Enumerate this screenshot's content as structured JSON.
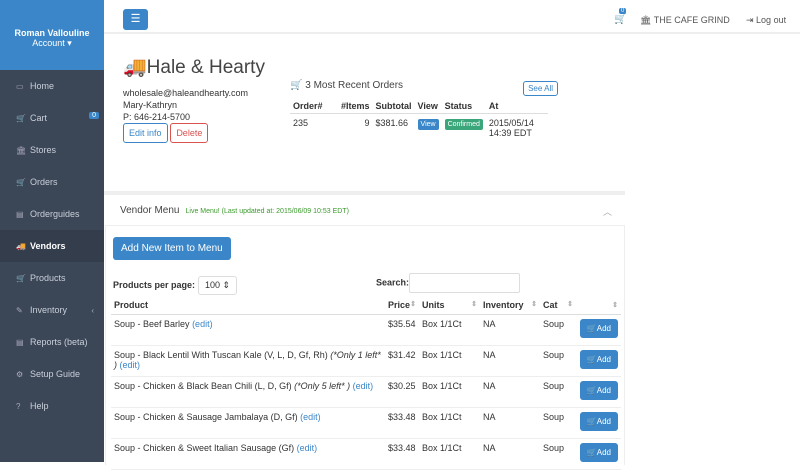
{
  "sidebar": {
    "user": "Roman Vallouline",
    "account": "Account ▾",
    "items": [
      {
        "label": "Home",
        "icon": "laptop-icon",
        "glyph": "▭"
      },
      {
        "label": "Cart",
        "icon": "cart-icon",
        "glyph": "🛒",
        "badge": "0"
      },
      {
        "label": "Stores",
        "icon": "bank-icon",
        "glyph": "🏛"
      },
      {
        "label": "Orders",
        "icon": "cart-icon",
        "glyph": "🛒"
      },
      {
        "label": "Orderguides",
        "icon": "list-icon",
        "glyph": "▤"
      },
      {
        "label": "Vendors",
        "icon": "truck-icon",
        "glyph": "🚚",
        "active": true
      },
      {
        "label": "Products",
        "icon": "cart-icon",
        "glyph": "🛒"
      },
      {
        "label": "Inventory",
        "icon": "pencil-icon",
        "glyph": "✎",
        "chevron": "‹"
      },
      {
        "label": "Reports (beta)",
        "icon": "document-icon",
        "glyph": "▤"
      },
      {
        "label": "Setup Guide",
        "icon": "gear-icon",
        "glyph": "⚙"
      },
      {
        "label": "Help",
        "icon": "help-icon",
        "glyph": "?"
      }
    ]
  },
  "topbar": {
    "menu": "☰",
    "cart_badge": "0",
    "store": "THE CAFE GRIND",
    "logout": "Log out"
  },
  "vendor": {
    "name": "Hale & Hearty",
    "email": "wholesale@haleandhearty.com",
    "contact": "Mary-Kathryn",
    "phone": "P: 646-214-5700",
    "edit": "Edit info",
    "delete": "Delete"
  },
  "orders": {
    "title": "3 Most Recent Orders",
    "see_all": "See All",
    "headers": [
      "Order#",
      "#Items",
      "Subtotal",
      "View",
      "Status",
      "At"
    ],
    "rows": [
      {
        "order": "235",
        "items": "9",
        "subtotal": "$381.66",
        "view": "View",
        "status": "Confirmed",
        "at": "2015/05/14 14:39 EDT"
      }
    ]
  },
  "menu": {
    "title": "Vendor Menu",
    "live": "Live Menu! (Last updated at: 2015/06/09 10:53 EDT)",
    "add_new": "Add New Item to Menu",
    "ppp_label": "Products per page:",
    "ppp_value": "100",
    "search_label": "Search:",
    "search_value": "",
    "headers": [
      "Product",
      "Price",
      "Units",
      "Inventory",
      "Cat",
      ""
    ],
    "rows": [
      {
        "product": "Soup - Beef Barley",
        "note": "",
        "price": "$35.54",
        "units": "Box 1/1Ct",
        "inventory": "NA",
        "cat": "Soup"
      },
      {
        "product": "Soup - Black Lentil With Tuscan Kale (V, L, D, Gf, Rh)",
        "note": "(*Only 1 left* )",
        "price": "$31.42",
        "units": "Box 1/1Ct",
        "inventory": "NA",
        "cat": "Soup"
      },
      {
        "product": "Soup - Chicken & Black Bean Chili (L, D, Gf)",
        "note": "(*Only 5 left* )",
        "price": "$30.25",
        "units": "Box 1/1Ct",
        "inventory": "NA",
        "cat": "Soup"
      },
      {
        "product": "Soup - Chicken & Sausage Jambalaya (D, Gf)",
        "note": "",
        "price": "$33.48",
        "units": "Box 1/1Ct",
        "inventory": "NA",
        "cat": "Soup"
      },
      {
        "product": "Soup - Chicken & Sweet Italian Sausage (Gf)",
        "note": "",
        "price": "$33.48",
        "units": "Box 1/1Ct",
        "inventory": "NA",
        "cat": "Soup"
      }
    ],
    "edit": "(edit)",
    "add": "Add"
  },
  "colors": {
    "primary": "#3a86c8",
    "sidebar": "#3b4656",
    "success": "#3aa67a",
    "danger": "#d9534f"
  }
}
